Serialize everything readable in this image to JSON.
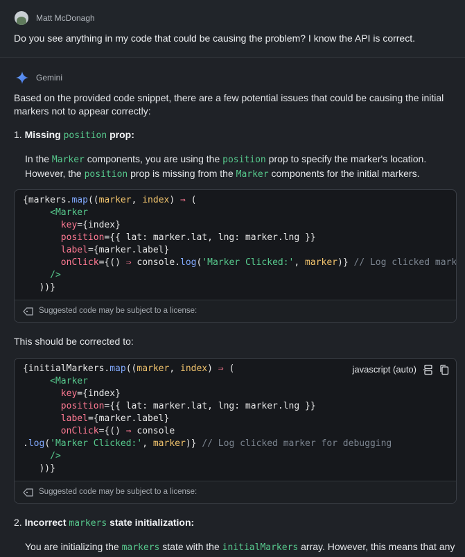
{
  "user": {
    "name": "Matt McDonagh",
    "message": "Do you see anything in my code that could be causing the problem? I know the API is correct."
  },
  "assistant": {
    "name": "Gemini",
    "intro": [
      "Based on the provided code snippet, there are a few potential issues that could be causing the initial",
      "markers not to appear correctly:"
    ],
    "item1": {
      "num": "1.",
      "title_a": "Missing",
      "title_code": "position",
      "title_b": "prop:",
      "line1": [
        "In the",
        "Marker",
        "components, you are using the",
        "position",
        "prop to specify the marker's location."
      ],
      "line2": [
        "However, the",
        "position",
        "prop is missing from the",
        "Marker",
        "components for the initial markers."
      ]
    },
    "code1": {
      "lines": [
        "{markers.map((marker, index) ⇒ (",
        "     <Marker",
        "       key={index}",
        "       position={{ lat: marker.lat, lng: marker.lng }}",
        "       label={marker.label}",
        "       onClick={() ⇒ console.log('Marker Clicked:', marker)} // Log clicked marker for debugging",
        "     />",
        "   ))}"
      ],
      "license": "Suggested code may be subject to a license:"
    },
    "corrected_text": "This should be corrected to:",
    "code2": {
      "language": "javascript (auto)",
      "lines": [
        "{initialMarkers.map((marker, index) ⇒ (",
        "     <Marker",
        "       key={index}",
        "       position={{ lat: marker.lat, lng: marker.lng }}",
        "       label={marker.label}",
        "       onClick={() ⇒ console",
        ".log('Marker Clicked:', marker)} // Log clicked marker for debugging",
        "     />",
        "   ))}"
      ],
      "license": "Suggested code may be subject to a license:"
    },
    "item2": {
      "num": "2.",
      "title_a": "Incorrect",
      "title_code": "markers",
      "title_b": "state initialization:",
      "line1": [
        "You are initializing the",
        "markers",
        "state with the",
        "initialMarkers",
        "array. However, this means that any"
      ]
    }
  },
  "colors": {
    "background": "#1f2227",
    "code_background": "#16181c",
    "inline_code": "#57c98d",
    "gemini_blue": "#4c8df6"
  }
}
